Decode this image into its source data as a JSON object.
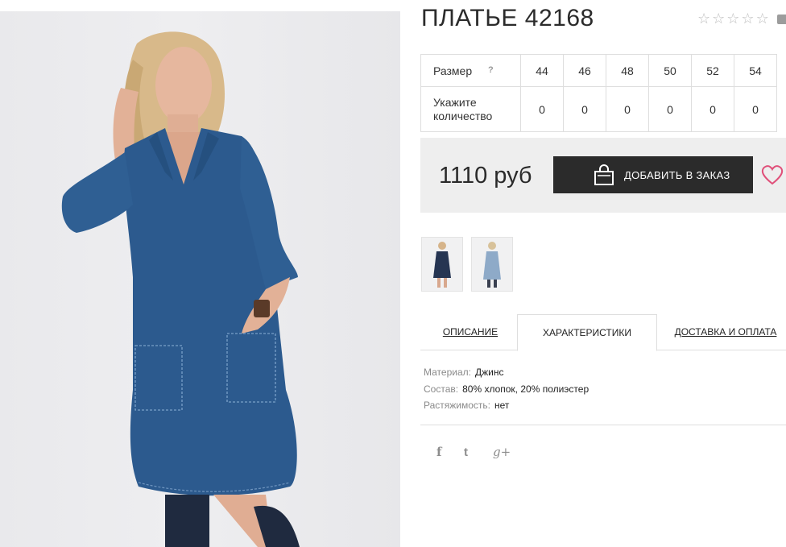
{
  "product": {
    "title": "ПЛАТЬЕ 42168",
    "rating": {
      "stars_filled": 0,
      "stars_total": 5
    },
    "price": "1110 руб",
    "order_button": "ДОБАВИТЬ В ЗАКАЗ",
    "photo_icon": "denim-dress-photo"
  },
  "size_table": {
    "size_label": "Размер",
    "help_mark": "?",
    "qty_label_line1": "Укажите",
    "qty_label_line2": "количество",
    "sizes": [
      "44",
      "46",
      "48",
      "50",
      "52",
      "54"
    ],
    "quantities": [
      "0",
      "0",
      "0",
      "0",
      "0",
      "0"
    ]
  },
  "thumbnails": [
    "dark-denim-dress-thumb",
    "light-denim-dress-thumb"
  ],
  "tabs": [
    {
      "label": "ОПИСАНИЕ",
      "active": false
    },
    {
      "label": "ХАРАКТЕРИСТИКИ",
      "active": true
    },
    {
      "label": "ДОСТАВКА И ОПЛАТА",
      "active": false
    }
  ],
  "specs": [
    {
      "key": "Материал:",
      "value": "Джинс"
    },
    {
      "key": "Состав:",
      "value": "80% хлопок, 20% полиэстер"
    },
    {
      "key": "Растяжимость:",
      "value": "нет"
    }
  ],
  "social": [
    {
      "icon": "facebook-icon",
      "glyph": "f"
    },
    {
      "icon": "twitter-icon",
      "glyph": "t"
    },
    {
      "icon": "google-plus-icon",
      "glyph": "g+"
    }
  ],
  "colors": {
    "button_bg": "#2b2b2b",
    "price_box_bg": "#eeeeee",
    "heart": "#e0507a",
    "dress": "#2c5a8e"
  }
}
